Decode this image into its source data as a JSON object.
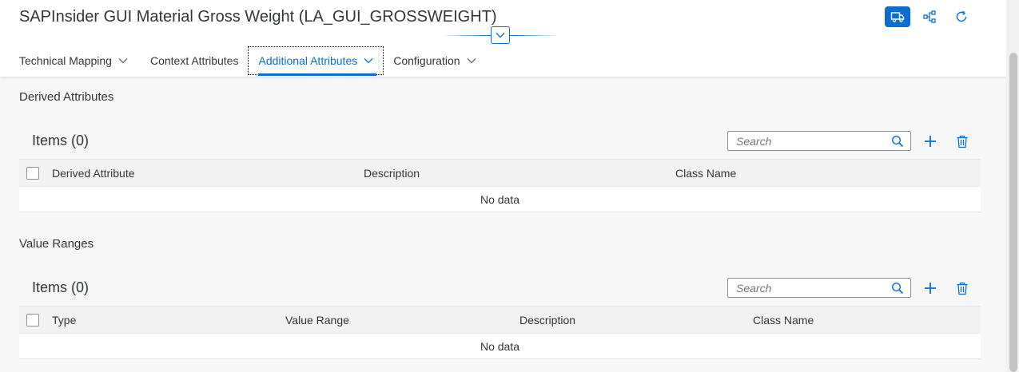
{
  "header": {
    "title": "SAPInsider GUI Material Gross Weight (LA_GUI_GROSSWEIGHT)",
    "actions": [
      "truck-icon",
      "share-network-icon",
      "refresh-icon"
    ]
  },
  "tabs": [
    {
      "label": "Technical Mapping",
      "has_menu": true
    },
    {
      "label": "Context Attributes",
      "has_menu": false
    },
    {
      "label": "Additional Attributes",
      "has_menu": true,
      "selected": true
    },
    {
      "label": "Configuration",
      "has_menu": true
    }
  ],
  "derived": {
    "section_title": "Derived Attributes",
    "items_title": "Items (0)",
    "search_placeholder": "Search",
    "columns": [
      "Derived Attribute",
      "Description",
      "Class Name"
    ],
    "no_data": "No data"
  },
  "value_ranges": {
    "section_title": "Value Ranges",
    "items_title": "Items (0)",
    "search_placeholder": "Search",
    "columns": [
      "Type",
      "Value Range",
      "Description",
      "Class Name"
    ],
    "no_data": "No data"
  },
  "colors": {
    "accent": "#0a6ed1",
    "background": "#f7f7f7",
    "text": "#32363a"
  }
}
